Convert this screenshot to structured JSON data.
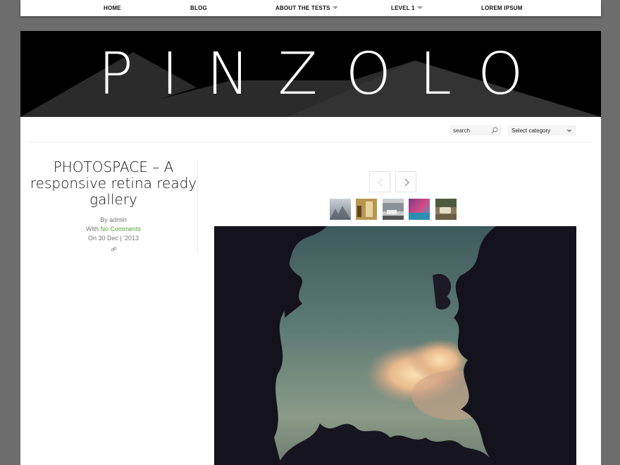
{
  "nav": {
    "items": [
      {
        "label": "HOME"
      },
      {
        "label": "BLOG"
      },
      {
        "label": "ABOUT THE TESTS"
      },
      {
        "label": "LEVEL 1"
      },
      {
        "label": "LOREM IPSUM"
      }
    ]
  },
  "header": {
    "logo": "PINZOLO"
  },
  "search": {
    "placeholder": "search"
  },
  "category": {
    "selected": "Select category"
  },
  "post": {
    "title": "PHOTOSPACE – A responsive retina ready gallery",
    "by_label": "By admin",
    "with_prefix": "With ",
    "comments_link": "No Comments",
    "date_label": "On 30 Dec | '2013"
  },
  "gallery": {
    "thumbnails": [
      "thumb-1",
      "thumb-2",
      "thumb-3",
      "thumb-4",
      "thumb-5"
    ]
  },
  "icons": {
    "search": "search-icon",
    "link": "link-icon",
    "prev": "chevron-left-icon",
    "next": "chevron-right-icon"
  },
  "colors": {
    "link": "#5aa33a",
    "background": "#6d6d6d"
  }
}
